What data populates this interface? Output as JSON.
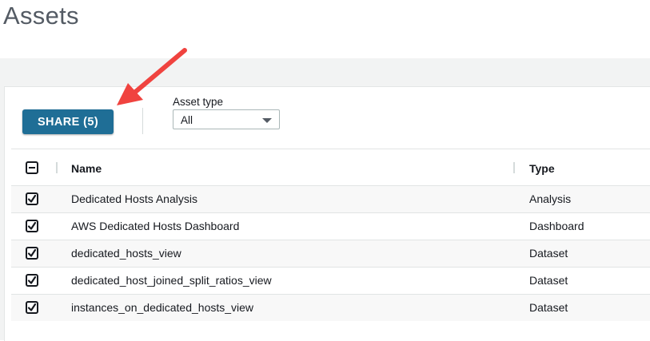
{
  "page": {
    "title": "Assets"
  },
  "toolbar": {
    "share_label": "SHARE (5)",
    "asset_type_label": "Asset type",
    "asset_type_value": "All"
  },
  "table": {
    "columns": [
      "Name",
      "Type"
    ],
    "rows": [
      {
        "name": "Dedicated Hosts Analysis",
        "type": "Analysis",
        "checked": true
      },
      {
        "name": "AWS Dedicated Hosts Dashboard",
        "type": "Dashboard",
        "checked": true
      },
      {
        "name": "dedicated_hosts_view",
        "type": "Dataset",
        "checked": true
      },
      {
        "name": "dedicated_host_joined_split_ratios_view",
        "type": "Dataset",
        "checked": true
      },
      {
        "name": "instances_on_dedicated_hosts_view",
        "type": "Dataset",
        "checked": true
      }
    ]
  },
  "colors": {
    "accent": "#1f6e96",
    "annotation_arrow": "#f0433f"
  }
}
